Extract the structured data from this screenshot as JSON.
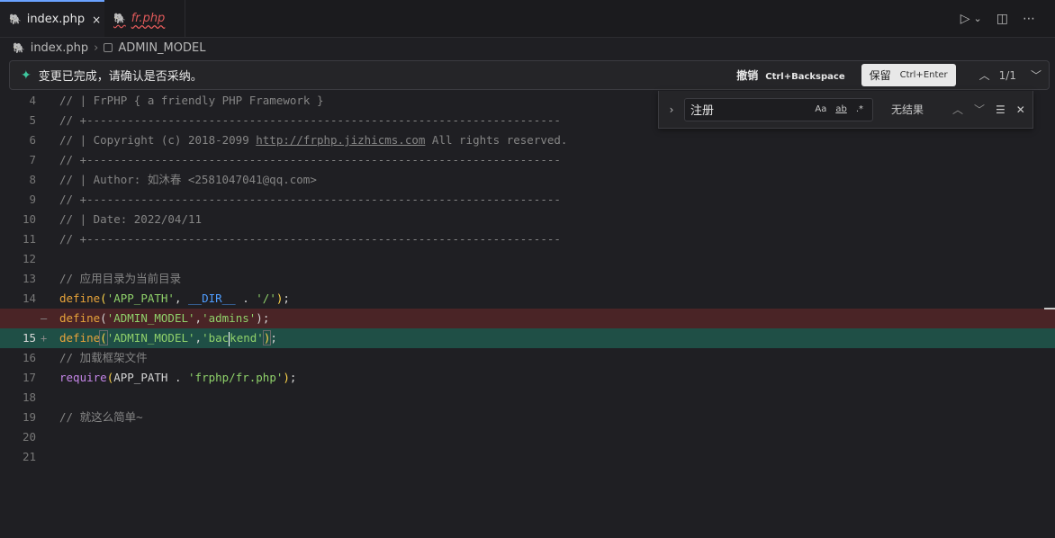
{
  "tabs": [
    {
      "label": "index.php",
      "icon": "php-elephant-icon",
      "close": "×"
    },
    {
      "label": "fr.php",
      "icon": "php-elephant-icon"
    }
  ],
  "tab_actions": {
    "run_icon": "▷",
    "dropdown_icon": "⌄",
    "split_icon": "◫",
    "more_icon": "⋯"
  },
  "breadcrumb": {
    "file": "index.php",
    "symbol": "ADMIN_MODEL"
  },
  "chat": {
    "message": "变更已完成，请确认是否采纳。",
    "undo_label": "撤销",
    "undo_shortcut": "Ctrl+Backspace",
    "keep_label": "保留",
    "keep_shortcut": "Ctrl+Enter",
    "counter": "1/1"
  },
  "find": {
    "query": "注册",
    "match_case": "Aa",
    "whole_word": "ab",
    "regex": ".*",
    "result": "无结果"
  },
  "lines": [
    {
      "n": "4",
      "text": "// | FrPHP { a friendly PHP Framework }"
    },
    {
      "n": "5",
      "text": "// +----------------------------------------------------------------------"
    },
    {
      "n": "6",
      "pre": "// | Copyright (c) 2018-2099 ",
      "link": "http://frphp.jizhicms.com",
      "post": " All rights reserved."
    },
    {
      "n": "7",
      "text": "// +----------------------------------------------------------------------"
    },
    {
      "n": "8",
      "text": "// | Author: 如沐春 <2581047041@qq.com>"
    },
    {
      "n": "9",
      "text": "// +----------------------------------------------------------------------"
    },
    {
      "n": "10",
      "text": "// | Date: 2022/04/11"
    },
    {
      "n": "11",
      "text": "// +----------------------------------------------------------------------"
    },
    {
      "n": "12",
      "text": ""
    },
    {
      "n": "13",
      "text": "// 应用目录为当前目录"
    },
    {
      "n": "14",
      "fn": "define",
      "a1": "'APP_PATH'",
      "mid": ", ",
      "const": "__DIR__",
      "dot": " . ",
      "a2": "'/'",
      "end": ";"
    },
    {
      "n": "",
      "marker": "—",
      "fn": "define",
      "a1": "'ADMIN_MODEL'",
      "mid": ",",
      "a2": "'admins'",
      "end": ";"
    },
    {
      "n": "15",
      "marker": "+",
      "fn": "define",
      "a1": "'ADMIN_MODEL'",
      "mid": ",",
      "a2a": "'bac",
      "a2b": "kend'",
      "end": ";"
    },
    {
      "n": "16",
      "text": "// 加载框架文件"
    },
    {
      "n": "17",
      "kw": "require",
      "arg": "APP_PATH",
      "dot": " . ",
      "a2": "'frphp/fr.php'",
      "end": ";"
    },
    {
      "n": "18",
      "text": ""
    },
    {
      "n": "19",
      "text": "// 就这么简单~"
    },
    {
      "n": "20",
      "text": ""
    },
    {
      "n": "21",
      "text": ""
    }
  ]
}
